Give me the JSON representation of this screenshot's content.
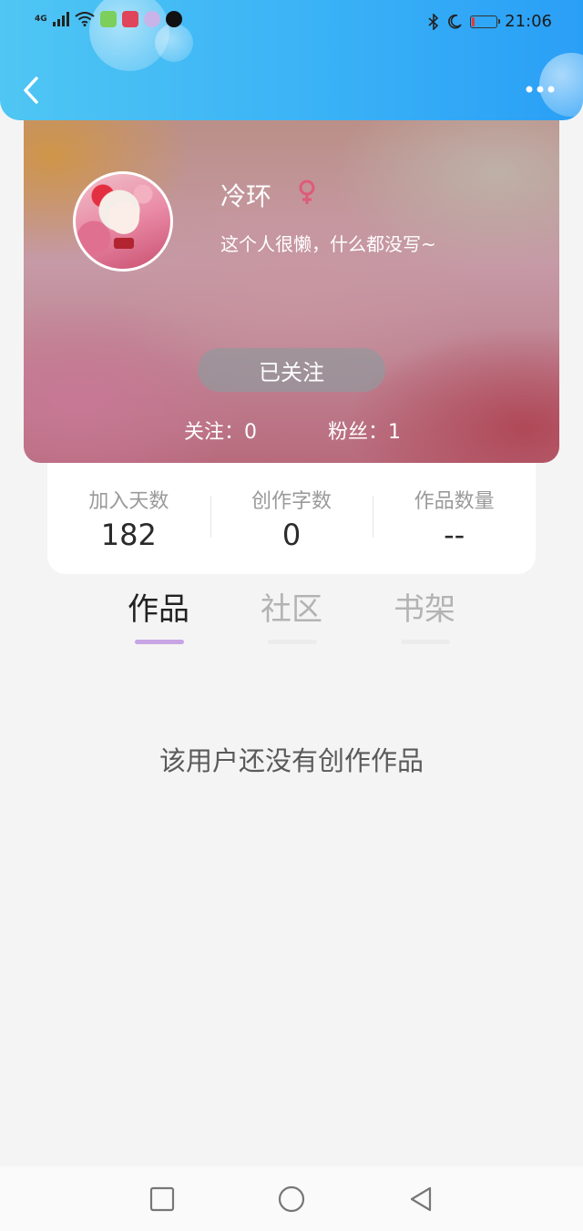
{
  "status_bar": {
    "network": "4G",
    "time": "21:06",
    "battery_level": 0.12,
    "app_icons": [
      "wechat-icon",
      "red-app-icon",
      "purple-app-icon",
      "tiktok-icon"
    ]
  },
  "header": {
    "back_icon": "chevron-left-icon",
    "more_icon": "more-dots-icon"
  },
  "profile": {
    "name": "冷环",
    "gender_icon": "female-icon",
    "bio": "这个人很懒，什么都没写~",
    "follow_button": "已关注",
    "following": "关注：0",
    "followers": "粉丝：1"
  },
  "stats": [
    {
      "label": "加入天数",
      "value": "182"
    },
    {
      "label": "创作字数",
      "value": "0"
    },
    {
      "label": "作品数量",
      "value": "--"
    }
  ],
  "tabs": [
    {
      "label": "作品",
      "active": true
    },
    {
      "label": "社区",
      "active": false
    },
    {
      "label": "书架",
      "active": false
    }
  ],
  "empty_message": "该用户还没有创作作品",
  "colors": {
    "header_blue": "#3ab2f6",
    "tab_indicator": "#c7a4e4",
    "follow_button_bg": "#96969b"
  }
}
